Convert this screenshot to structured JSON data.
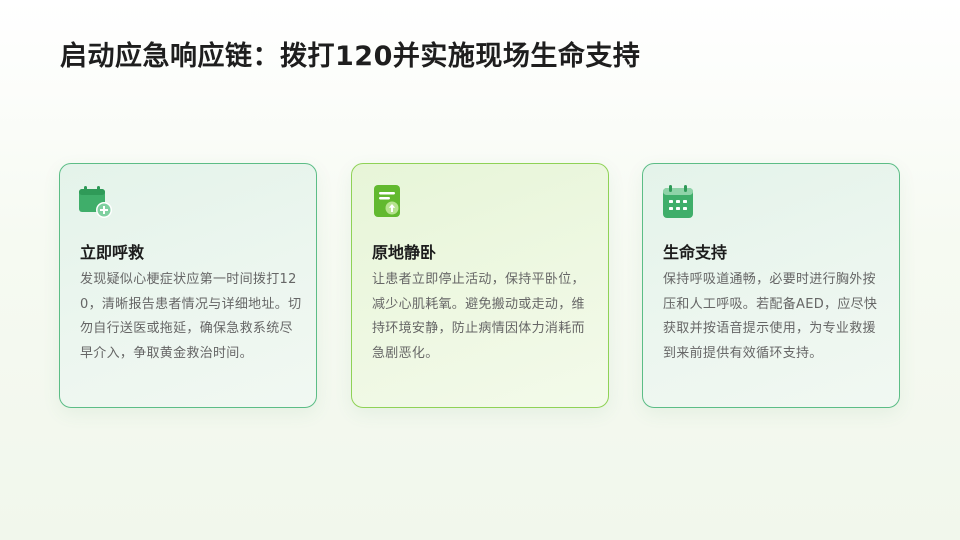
{
  "slide": {
    "title": "启动应急响应链：拨打120并实施现场生命支持"
  },
  "colors": {
    "accent_green": "#3fae6a",
    "accent_lime": "#62b92f",
    "card_border": "#5cbd86"
  },
  "cards": [
    {
      "icon": "calendar-add-icon",
      "title": "立即呼救",
      "text": "发现疑似心梗症状应第一时间拨打120，清晰报告患者情况与详细地址。切勿自行送医或拖延，确保急救系统尽早介入，争取黄金救治时间。"
    },
    {
      "icon": "document-upload-icon",
      "title": "原地静卧",
      "text": "让患者立即停止活动，保持平卧位，减少心肌耗氧。避免搬动或走动，维持环境安静，防止病情因体力消耗而急剧恶化。"
    },
    {
      "icon": "calendar-grid-icon",
      "title": "生命支持",
      "text": "保持呼吸道通畅，必要时进行胸外按压和人工呼吸。若配备AED，应尽快获取并按语音提示使用，为专业救援到来前提供有效循环支持。"
    }
  ]
}
